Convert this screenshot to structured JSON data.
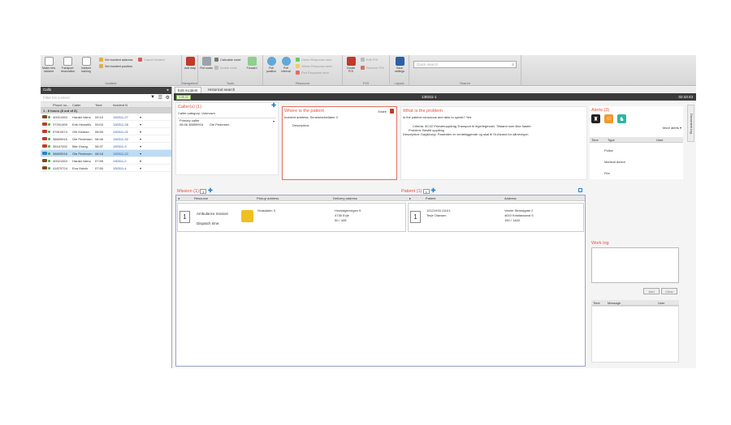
{
  "ribbon": {
    "incident_group": {
      "buttons": [
        {
          "label": "Make new incident",
          "icon": "new-incident-icon"
        },
        {
          "label": "Transport reservation",
          "icon": "transport-reservation-icon"
        },
        {
          "label": "Incident training",
          "icon": "incident-training-icon"
        }
      ],
      "small_buttons": [
        {
          "label": "Set incident address",
          "icon": "set-address-icon"
        },
        {
          "label": "Cancel incident",
          "icon": "cancel-incident-icon"
        },
        {
          "label": "Set incident position",
          "icon": "set-position-icon"
        }
      ],
      "label": "Incident"
    },
    "navigation_group": {
      "buttons": [
        {
          "label": "Add map",
          "icon": "add-map-icon"
        }
      ],
      "label": "Navigation"
    },
    "tools_group": {
      "buttons": [
        {
          "label": "Plot roads",
          "icon": "plot-roads-icon"
        },
        {
          "label": "Forward",
          "icon": "forward-icon"
        }
      ],
      "small_buttons": [
        {
          "label": "Calculate route",
          "icon": "calculate-route-icon"
        },
        {
          "label": "Delete route",
          "icon": "delete-route-icon"
        }
      ],
      "label": "Tools"
    },
    "resource_group": {
      "buttons": [
        {
          "label": "Poll position",
          "icon": "poll-position-icon"
        },
        {
          "label": "Poll interval",
          "icon": "poll-interval-icon"
        }
      ],
      "small_buttons": [
        {
          "label": "Green Response area",
          "icon": "green-area-icon"
        },
        {
          "label": "Yellow Response area",
          "icon": "yellow-area-icon"
        },
        {
          "label": "Red Response area",
          "icon": "red-area-icon"
        }
      ],
      "label": "Resource"
    },
    "poi_group": {
      "buttons": [
        {
          "label": "Create POI",
          "icon": "create-poi-icon"
        }
      ],
      "small_buttons": [
        {
          "label": "Edit POI",
          "icon": "edit-poi-icon"
        },
        {
          "label": "Remove POI",
          "icon": "remove-poi-icon"
        }
      ],
      "label": "POI"
    },
    "layout_group": {
      "buttons": [
        {
          "label": "Save settings",
          "icon": "save-settings-icon"
        }
      ],
      "label": "Layout"
    },
    "search_group": {
      "placeholder": "Quick search",
      "label": "Search"
    }
  },
  "left": {
    "header": "Calls",
    "filter_placeholder": "Filter list content",
    "columns": [
      "Phone nu...",
      "Caller",
      "Time",
      "Incident N"
    ],
    "group_label": "1 - 8 hours (8 out of 8)",
    "rows": [
      {
        "phone": "40021063",
        "caller": "Harald Vaino",
        "time": "09:10",
        "incident": "130311-27",
        "icon_color": "#7a4a1e",
        "selected": false
      },
      {
        "phone": "37291459",
        "caller": "Erik Hessells",
        "time": "09:03",
        "incident": "130311-28",
        "icon_color": "#c0392b",
        "selected": false
      },
      {
        "phone": "97810574",
        "caller": "Ole Kristian",
        "time": "08:55",
        "incident": "130311-21",
        "icon_color": "#c0392b",
        "selected": false
      },
      {
        "phone": "38659916",
        "caller": "Ole Pedersen",
        "time": "08:46",
        "incident": "130311-32",
        "icon_color": "#c0392b",
        "selected": false
      },
      {
        "phone": "38167092",
        "caller": "Bile Grang",
        "time": "08:37",
        "incident": "130311-3",
        "icon_color": "#c0392b",
        "selected": false
      },
      {
        "phone": "38659916",
        "caller": "Ole Pedersen",
        "time": "08:18",
        "incident": "130311-22",
        "icon_color": "#2d7fc9",
        "selected": true
      },
      {
        "phone": "40021063",
        "caller": "Harald Vaino",
        "time": "07:59",
        "incident": "130311-2",
        "icon_color": "#7a4a1e",
        "selected": false
      },
      {
        "phone": "41879724",
        "caller": "Eva Hotvik",
        "time": "07:50",
        "incident": "130311-4",
        "icon_color": "#7a4a1e",
        "selected": false
      }
    ]
  },
  "main": {
    "tabs": [
      "Edit incident",
      "Historical search"
    ],
    "incident_id": "130311-1",
    "clock": "02:43:43",
    "status_chip": "V.05.22",
    "callers": {
      "title": "Caller(s) (1)",
      "category": "Caller category: Unknown",
      "primary_label": "Primary caller",
      "time_phone": "08:46 38659916",
      "name": "Ole Pedersen"
    },
    "patient_location": {
      "title": "Where is the patient",
      "edit_label": "Endre",
      "address": "Incident address: Seuenesdveltane 0",
      "description": "Description:"
    },
    "problem": {
      "title": "What is the problem",
      "question": "Is the patient conscious and able to speak?   Yes",
      "criteria": "Criteria: 50.02 Primæroppdrag Transport til lege/legevakt. Tilstand som ikke haster.",
      "problem": "Problem: Bestilt oppdrag",
      "description": "Description: Dagkirurgi. Pasienten er venteklggende og skal til St.Alvand for sårrevisjon"
    },
    "mission": {
      "title": "Mission (1)",
      "count": "1",
      "columns": [
        "Resource",
        "Pickup address",
        "Delivery address"
      ],
      "number": "1",
      "resource_name": "Ambulance mission",
      "resource_sub": "Dispatch time:",
      "pickup": "Grasdalen 3",
      "delivery": [
        "Hovslagervegen 9",
        "4735 Evje",
        "50 / 428"
      ]
    },
    "patients": {
      "title": "Patient (1)",
      "count": "1",
      "columns": [
        "Patient",
        "Address"
      ],
      "number": "1",
      "patient": [
        "12121933 11101",
        "Terje  Olavsen"
      ],
      "address": [
        "Vestre Strandgate 2",
        "4610 Kristiansand S",
        "150 / 1463"
      ]
    },
    "alerts": {
      "title": "Alerts (3)",
      "more": "More alerts ▾",
      "columns": [
        "Time",
        "Type",
        "User"
      ],
      "items": [
        "Police",
        "Medical doctor",
        "Fire"
      ]
    },
    "worklog": {
      "title": "Work log",
      "add_label": "Add",
      "clear_label": "Clear",
      "columns": [
        "Time",
        "Message",
        "User"
      ]
    },
    "side_tab": "Document log"
  }
}
